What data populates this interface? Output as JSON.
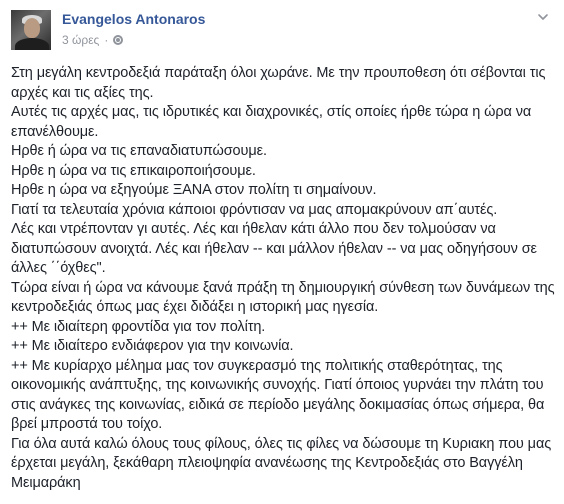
{
  "post": {
    "author": "Evangelos Antonaros",
    "time": "3 ώρες",
    "separator": "·",
    "icons": {
      "avatar": "profile-photo",
      "audience": "globe-icon",
      "menu": "chevron-down-icon"
    },
    "lines": [
      "Στη μεγάλη κεντροδεξιά παράταξη όλοι χωράνε. Με την προυποθεση ότι σέβονται τις αρχές και τις αξίες της.",
      "Αυτές τις αρχές μας, τις ιδρυτικές και διαχρονικές, στίς οποίες ήρθε τώρα η ώρα να επανέλθουμε.",
      "Ηρθε ή ώρα να τις επαναδιατυπώσουμε.",
      "Ηρθε η ώρα να τις επικαιροποιήσουμε.",
      "Ηρθε η ώρα να εξηγούμε ΞΑΝΑ στον πολίτη τι σημαίνουν.",
      "Γιατί τα τελευταία χρόνια κάποιοι φρόντισαν να μας απομακρύνουν απ΄αυτές.",
      "Λές και ντρέπονταν γι αυτές. Λές και ήθελαν κάτι άλλο που δεν τολμούσαν να διατυπώσουν ανοιχτά. Λές και ήθελαν -- και μάλλον ήθελαν -- να μας οδηγήσουν σε άλλες ΄΄όχθες\".",
      "Τώρα είναι ή ώρα να κάνουμε ξανά πράξη τη δημιουργική σύνθεση των δυνάμεων της κεντροδεξιάς όπως μας έχει διδάξει η ιστορική μας ηγεσία.",
      "++ Με ιδιαίτερη φροντίδα για τον πολίτη.",
      "++ Με ιδιαίτερο ενδιάφερον για την κοινωνία.",
      "++ Με κυρίαρχο μέλημα μας τον συγκερασμό της πολιτικής σταθερότητας, της οικονομικής ανάπτυξης, της κοινωνικής συνοχής. Γιατί όποιος γυρνάει την πλάτη του στις ανάγκες της κοινωνίας, ειδικά σε περίοδο μεγάλης δοκιμασίας όπως σήμερα, θα βρεί μπροστά του τοίχο.",
      "Για όλα αυτά καλώ όλους τους φίλους, όλες τις φίλες να δώσουμε τη Κυριακη που μας έρχεται μεγάλη, ξεκάθαρη πλειοψηφία ανανέωσης της Κεντροδεξιάς στο Βαγγέλη Μειμαράκη"
    ]
  }
}
